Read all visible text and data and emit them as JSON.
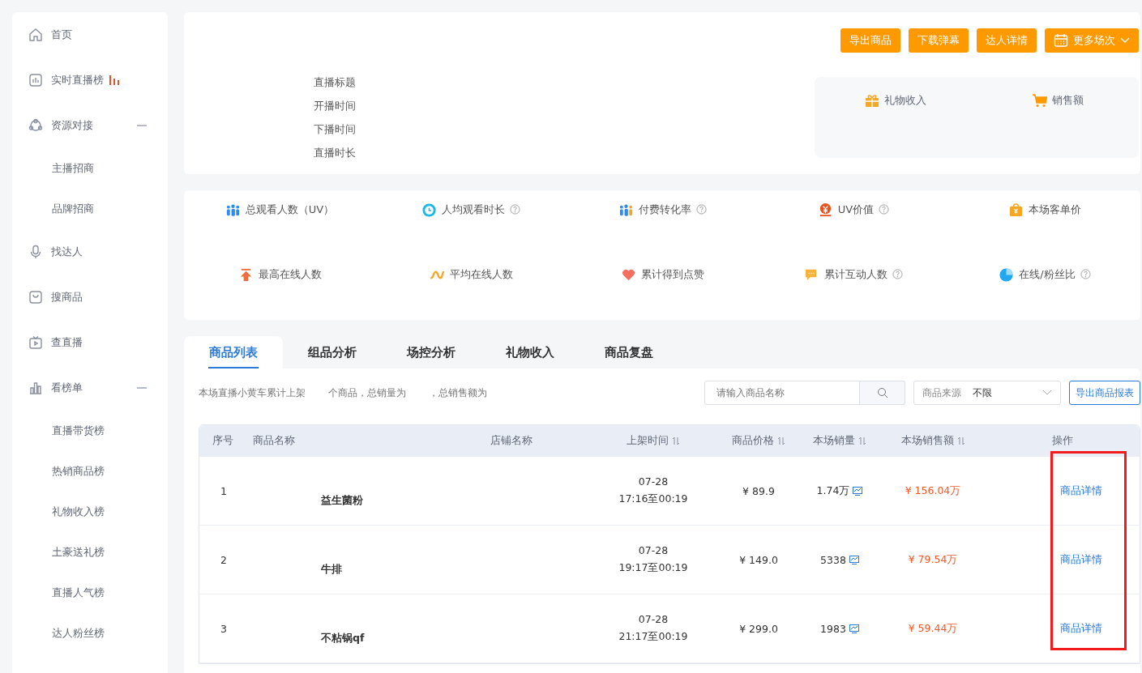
{
  "sidebar": {
    "items": [
      {
        "kind": "item",
        "label": "首页"
      },
      {
        "kind": "item",
        "label": "实时直播榜",
        "hot": true
      },
      {
        "kind": "group",
        "label": "资源对接",
        "expanded": true,
        "children": [
          {
            "label": "主播招商"
          },
          {
            "label": "品牌招商"
          }
        ]
      },
      {
        "kind": "item",
        "label": "找达人"
      },
      {
        "kind": "item",
        "label": "搜商品"
      },
      {
        "kind": "item",
        "label": "查直播"
      },
      {
        "kind": "group",
        "label": "看榜单",
        "expanded": true,
        "children": [
          {
            "label": "直播带货榜"
          },
          {
            "label": "热销商品榜"
          },
          {
            "label": "礼物收入榜"
          },
          {
            "label": "土豪送礼榜"
          },
          {
            "label": "直播人气榜"
          },
          {
            "label": "达人粉丝榜"
          }
        ]
      }
    ]
  },
  "header": {
    "fields": [
      "直播标题",
      "开播时间",
      "下播时间",
      "直播时长"
    ],
    "buttons": [
      {
        "label": "导出商品"
      },
      {
        "label": "下载弹幕"
      },
      {
        "label": "达人详情"
      },
      {
        "label": "更多场次"
      }
    ],
    "stats": [
      {
        "label": "礼物收入"
      },
      {
        "label": "销售额"
      }
    ]
  },
  "metrics": [
    {
      "label": "总观看人数（UV）",
      "help": false
    },
    {
      "label": "人均观看时长",
      "help": true
    },
    {
      "label": "付费转化率",
      "help": true
    },
    {
      "label": "UV价值",
      "help": true
    },
    {
      "label": "本场客单价",
      "help": false
    },
    {
      "label": "最高在线人数",
      "help": false
    },
    {
      "label": "平均在线人数",
      "help": false
    },
    {
      "label": "累计得到点赞",
      "help": false
    },
    {
      "label": "累计互动人数",
      "help": true
    },
    {
      "label": "在线/粉丝比",
      "help": true
    }
  ],
  "tabs": [
    {
      "label": "商品列表",
      "selected": true
    },
    {
      "label": "组品分析",
      "selected": false
    },
    {
      "label": "场控分析",
      "selected": false
    },
    {
      "label": "礼物收入",
      "selected": false
    },
    {
      "label": "商品复盘",
      "selected": false
    }
  ],
  "summary": [
    "本场直播小黄车累计上架",
    "个商品，总销量为",
    "，总销售额为"
  ],
  "search": {
    "placeholder": "请输入商品名称"
  },
  "source": {
    "label": "商品来源",
    "value": "不限"
  },
  "export_button": "导出商品报表",
  "table": {
    "columns": [
      {
        "label": "序号",
        "sortable": false
      },
      {
        "label": "商品名称",
        "sortable": false
      },
      {
        "label": "店铺名称",
        "sortable": false
      },
      {
        "label": "上架时间",
        "sortable": true
      },
      {
        "label": "商品价格",
        "sortable": true
      },
      {
        "label": "本场销量",
        "sortable": true
      },
      {
        "label": "本场销售额",
        "sortable": true
      },
      {
        "label": "操作",
        "sortable": false
      }
    ],
    "rows": [
      {
        "index": "1",
        "name": "益生菌粉",
        "date": "07-28",
        "time": "17:16至00:19",
        "price": "¥ 89.9",
        "sales": "1.74万",
        "amount": "¥ 156.04万",
        "action": "商品详情"
      },
      {
        "index": "2",
        "name": "牛排",
        "date": "07-28",
        "time": "19:17至00:19",
        "price": "¥ 149.0",
        "sales": "5338",
        "amount": "¥ 79.54万",
        "action": "商品详情"
      },
      {
        "index": "3",
        "name": "不粘锅qf",
        "date": "07-28",
        "time": "21:17至00:19",
        "price": "¥ 299.0",
        "sales": "1983",
        "amount": "¥ 59.44万",
        "action": "商品详情"
      }
    ]
  }
}
